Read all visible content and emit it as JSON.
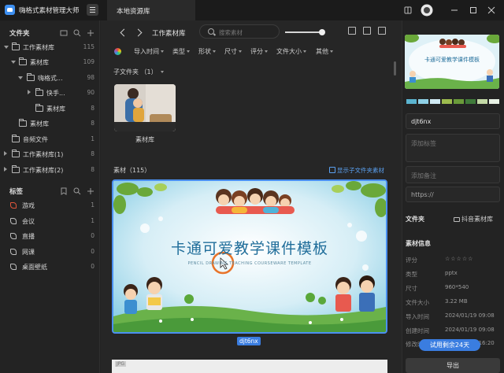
{
  "app": {
    "title": "嗨格式素材管理大师",
    "tab": "本地资源库"
  },
  "sidebar": {
    "folders_header": "文件夹",
    "folders": [
      {
        "label": "工作素材库",
        "count": "115"
      },
      {
        "label": "素材库",
        "count": "109"
      },
      {
        "label": "嗨格式...",
        "count": "98"
      },
      {
        "label": "快手...",
        "count": "90"
      },
      {
        "label": "素材库",
        "count": "8"
      },
      {
        "label": "素材库",
        "count": "8"
      },
      {
        "label": "音频文件",
        "count": "1"
      },
      {
        "label": "工作素材库(1)",
        "count": "8"
      },
      {
        "label": "工作素材库(2)",
        "count": "8"
      }
    ],
    "tags_header": "标签",
    "tags": [
      {
        "label": "游戏",
        "count": "1"
      },
      {
        "label": "会议",
        "count": "1"
      },
      {
        "label": "直播",
        "count": "0"
      },
      {
        "label": "网课",
        "count": "0"
      },
      {
        "label": "桌面壁纸",
        "count": "0"
      }
    ]
  },
  "toolbar": {
    "breadcrumb": "工作素材库",
    "search_placeholder": "搜索素材",
    "zoom_level": 0.94,
    "filters": [
      "导入时间",
      "类型",
      "形状",
      "尺寸",
      "评分",
      "文件大小",
      "其他"
    ]
  },
  "main": {
    "subfolders_heading": "子文件夹 （1）",
    "subfolder_name": "素材库",
    "materials_heading": "素材（115）",
    "show_sub_label": "显示子文件夹素材",
    "card_title": "卡通可爱教学课件模板",
    "card_subtitle": "PENCIL DRAWING TEACHING COURSEWARE TEMPLATE",
    "selected_name": "djt6nx",
    "next_badge": "JPG"
  },
  "details": {
    "swatches": [
      "#5bb4d0",
      "#8fd0e6",
      "#cfe9f2",
      "#9dbb4e",
      "#6a9b3a",
      "#3f7a3a",
      "#c3d9a6",
      "#e7f1e4"
    ],
    "name": "djt6nx",
    "tag_placeholder": "添加标签",
    "note_placeholder": "添加备注",
    "url_placeholder": "https://",
    "folder_label": "文件夹",
    "folder_value": "抖音素材库",
    "info_label": "素材信息",
    "info": [
      {
        "k": "评分",
        "v": "☆☆☆☆☆"
      },
      {
        "k": "类型",
        "v": "pptx"
      },
      {
        "k": "尺寸",
        "v": "960*540"
      },
      {
        "k": "文件大小",
        "v": "3.22 MB"
      },
      {
        "k": "导入时间",
        "v": "2024/01/19 09:08"
      },
      {
        "k": "创建时间",
        "v": "2024/01/19 09:08"
      },
      {
        "k": "修改时间",
        "v": "2024/01/19 16:20"
      }
    ],
    "trial_badge": "试用剩余24天",
    "export_button": "导出"
  }
}
